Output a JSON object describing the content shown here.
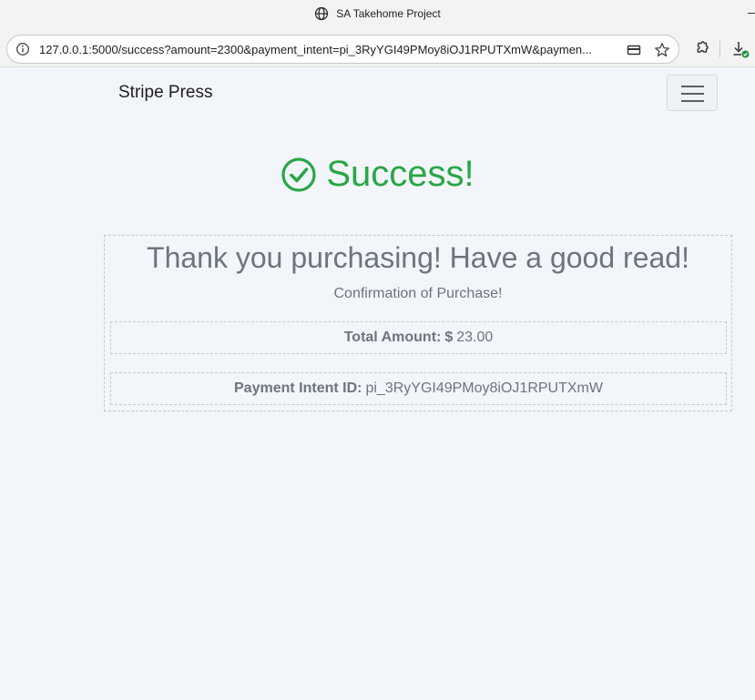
{
  "browser": {
    "window_title": "SA Takehome Project",
    "url": "127.0.0.1:5000/success?amount=2300&payment_intent=pi_3RyYGI49PMoy8iOJ1RPUTXmW&paymen..."
  },
  "nav": {
    "brand": "Stripe Press"
  },
  "success": {
    "heading": "Success!",
    "color": "#28a745"
  },
  "card": {
    "thanks": "Thank you purchasing! Have a good read!",
    "confirmation": "Confirmation of Purchase!",
    "total_label": "Total Amount:",
    "currency": "$",
    "total_value": "23.00",
    "intent_label": "Payment Intent ID:",
    "intent_value": "pi_3RyYGI49PMoy8iOJ1RPUTXmW"
  }
}
